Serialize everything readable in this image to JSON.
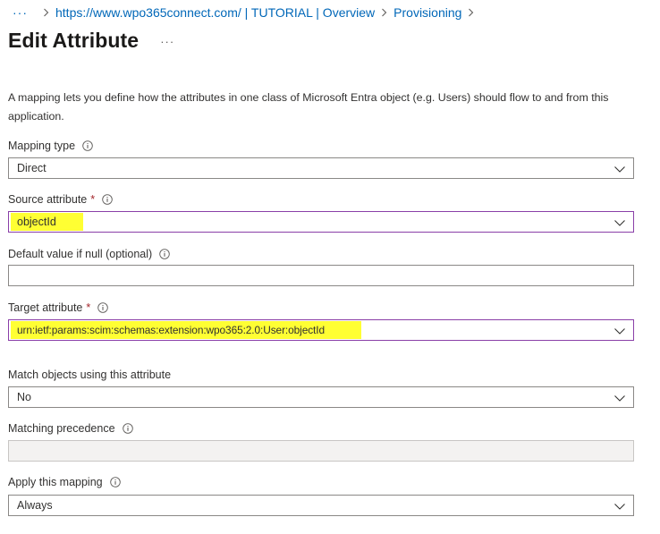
{
  "breadcrumb": {
    "more": "···",
    "items": [
      "https://www.wpo365connect.com/ | TUTORIAL | Overview",
      "Provisioning"
    ]
  },
  "header": {
    "title": "Edit Attribute",
    "more": "···"
  },
  "description": "A mapping lets you define how the attributes in one class of Microsoft Entra object (e.g. Users) should flow to and from this application.",
  "fields": {
    "mapping_type": {
      "label": "Mapping type",
      "value": "Direct"
    },
    "source_attribute": {
      "label": "Source attribute",
      "required": "*",
      "value": "objectId"
    },
    "default_value": {
      "label": "Default value if null (optional)",
      "value": ""
    },
    "target_attribute": {
      "label": "Target attribute",
      "required": "*",
      "value": "urn:ietf:params:scim:schemas:extension:wpo365:2.0:User:objectId"
    },
    "match_objects": {
      "label": "Match objects using this attribute",
      "value": "No"
    },
    "matching_precedence": {
      "label": "Matching precedence",
      "value": ""
    },
    "apply_mapping": {
      "label": "Apply this mapping",
      "value": "Always"
    }
  },
  "colors": {
    "link": "#0067b8",
    "highlight": "#ffff33",
    "focus_border": "#8a3fa8",
    "required": "#a4262c"
  }
}
